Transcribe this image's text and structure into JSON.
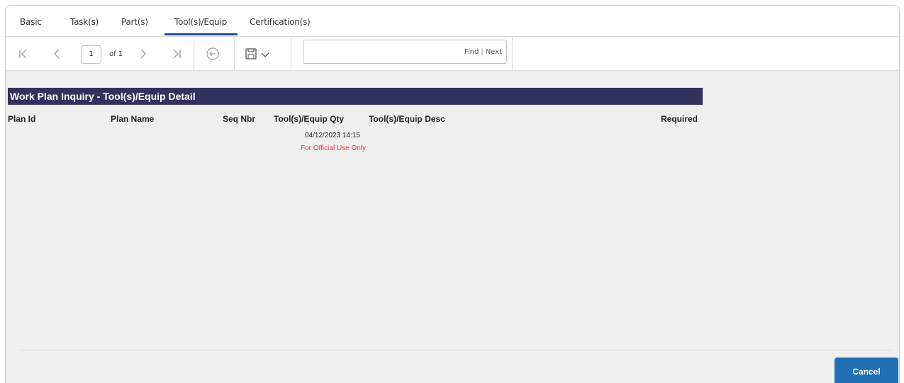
{
  "tabs": [
    {
      "label": "Basic"
    },
    {
      "label": "Task(s)"
    },
    {
      "label": "Part(s)"
    },
    {
      "label": "Tool(s)/Equip",
      "active": true
    },
    {
      "label": "Certification(s)"
    }
  ],
  "toolbar": {
    "page_current": "1",
    "page_of": "of 1",
    "find_label": "Find",
    "next_label": "Next",
    "find_placeholder": ""
  },
  "report": {
    "title": "Work Plan Inquiry - Tool(s)/Equip Detail",
    "columns": [
      "Plan Id",
      "Plan Name",
      "Seq Nbr",
      "Tool(s)/Equip Qty",
      "Tool(s)/Equip Desc",
      "Required"
    ],
    "timestamp": "04/12/2023 14:15",
    "notice": "For Official Use Only"
  },
  "footer": {
    "cancel_label": "Cancel"
  },
  "colors": {
    "banner": "#33325f",
    "accent": "#1f4e8c",
    "cancel": "#1f6fb2",
    "notice": "#e53935"
  },
  "icons": [
    "first-page-icon",
    "prev-page-icon",
    "next-page-icon",
    "last-page-icon",
    "back-icon",
    "save-icon",
    "chevron-down-icon"
  ]
}
